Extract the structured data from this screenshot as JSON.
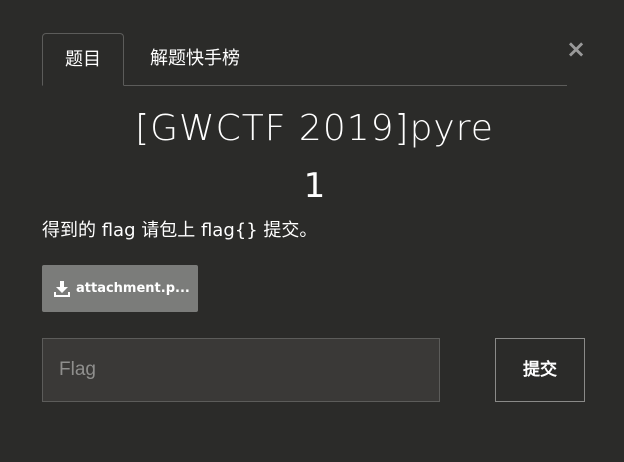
{
  "modal": {
    "close_symbol": "×"
  },
  "tabs": [
    {
      "label": "题目",
      "active": true
    },
    {
      "label": "解题快手榜",
      "active": false
    }
  ],
  "challenge": {
    "title": "[GWCTF 2019]pyre",
    "value": "1",
    "description": "得到的 flag 请包上 flag{} 提交。"
  },
  "attachment": {
    "icon": "download-icon",
    "label": "attachment.p..."
  },
  "flag_form": {
    "placeholder": "Flag",
    "value": "",
    "submit_label": "提交"
  },
  "colors": {
    "background": "#2b2b29",
    "attachment_bg": "#7b7c7a",
    "input_bg": "#3a3937",
    "border": "#5c5c5a"
  }
}
